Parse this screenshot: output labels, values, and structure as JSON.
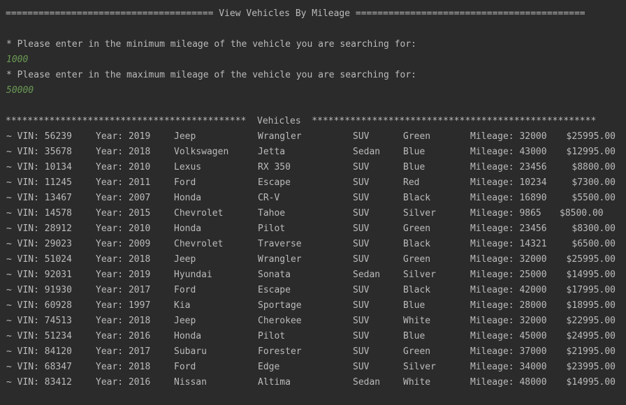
{
  "console": {
    "title_line": "====================================== View Vehicles By Mileage ==========================================",
    "prompt_min": "* Please enter in the minimum mileage of the vehicle you are searching for:",
    "input_min": "1000",
    "prompt_max": "* Please enter in the maximum mileage of the vehicle you are searching for:",
    "input_max": "50000",
    "vehicles_header": "********************************************  Vehicles  ****************************************************"
  },
  "vehicles": [
    {
      "vin": "~ VIN: 56239",
      "year": "Year: 2019",
      "make": "Jeep",
      "model": "Wrangler",
      "type": "SUV",
      "color": "Green",
      "mileage": "Mileage: 32000",
      "price": "$25995.00"
    },
    {
      "vin": "~ VIN: 35678",
      "year": "Year: 2018",
      "make": "Volkswagen",
      "model": "Jetta",
      "type": "Sedan",
      "color": "Blue",
      "mileage": "Mileage: 43000",
      "price": "$12995.00"
    },
    {
      "vin": "~ VIN: 10134",
      "year": "Year: 2010",
      "make": "Lexus",
      "model": "RX 350",
      "type": "SUV",
      "color": "Blue",
      "mileage": "Mileage: 23456",
      "price": "$8800.00"
    },
    {
      "vin": "~ VIN: 11245",
      "year": "Year: 2011",
      "make": "Ford",
      "model": "Escape",
      "type": "SUV",
      "color": "Red",
      "mileage": "Mileage: 10234",
      "price": "$7300.00"
    },
    {
      "vin": "~ VIN: 13467",
      "year": "Year: 2007",
      "make": "Honda",
      "model": "CR-V",
      "type": "SUV",
      "color": "Black",
      "mileage": "Mileage: 16890",
      "price": "$5500.00"
    },
    {
      "vin": "~ VIN: 14578",
      "year": "Year: 2015",
      "make": "Chevrolet",
      "model": "Tahoe",
      "type": "SUV",
      "color": "Silver",
      "mileage": "Mileage: 9865",
      "price": "$8500.00"
    },
    {
      "vin": "~ VIN: 28912",
      "year": "Year: 2010",
      "make": "Honda",
      "model": "Pilot",
      "type": "SUV",
      "color": "Green",
      "mileage": "Mileage: 23456",
      "price": "$8300.00"
    },
    {
      "vin": "~ VIN: 29023",
      "year": "Year: 2009",
      "make": "Chevrolet",
      "model": "Traverse",
      "type": "SUV",
      "color": "Black",
      "mileage": "Mileage: 14321",
      "price": "$6500.00"
    },
    {
      "vin": "~ VIN: 51024",
      "year": "Year: 2018",
      "make": "Jeep",
      "model": "Wrangler",
      "type": "SUV",
      "color": "Green",
      "mileage": "Mileage: 32000",
      "price": "$25995.00"
    },
    {
      "vin": "~ VIN: 92031",
      "year": "Year: 2019",
      "make": "Hyundai",
      "model": "Sonata",
      "type": "Sedan",
      "color": "Silver",
      "mileage": "Mileage: 25000",
      "price": "$14995.00"
    },
    {
      "vin": "~ VIN: 91930",
      "year": "Year: 2017",
      "make": "Ford",
      "model": "Escape",
      "type": "SUV",
      "color": "Black",
      "mileage": "Mileage: 42000",
      "price": "$17995.00"
    },
    {
      "vin": "~ VIN: 60928",
      "year": "Year: 1997",
      "make": "Kia",
      "model": "Sportage",
      "type": "SUV",
      "color": "Blue",
      "mileage": "Mileage: 28000",
      "price": "$18995.00"
    },
    {
      "vin": "~ VIN: 74513",
      "year": "Year: 2018",
      "make": "Jeep",
      "model": "Cherokee",
      "type": "SUV",
      "color": "White",
      "mileage": "Mileage: 32000",
      "price": "$22995.00"
    },
    {
      "vin": "~ VIN: 51234",
      "year": "Year: 2016",
      "make": "Honda",
      "model": "Pilot",
      "type": "SUV",
      "color": "Blue",
      "mileage": "Mileage: 45000",
      "price": "$24995.00"
    },
    {
      "vin": "~ VIN: 84120",
      "year": "Year: 2017",
      "make": "Subaru",
      "model": "Forester",
      "type": "SUV",
      "color": "Green",
      "mileage": "Mileage: 37000",
      "price": "$21995.00"
    },
    {
      "vin": "~ VIN: 68347",
      "year": "Year: 2018",
      "make": "Ford",
      "model": "Edge",
      "type": "SUV",
      "color": "Silver",
      "mileage": "Mileage: 34000",
      "price": "$23995.00"
    },
    {
      "vin": "~ VIN: 83412",
      "year": "Year: 2016",
      "make": "Nissan",
      "model": "Altima",
      "type": "Sedan",
      "color": "White",
      "mileage": "Mileage: 48000",
      "price": "$14995.00"
    }
  ]
}
